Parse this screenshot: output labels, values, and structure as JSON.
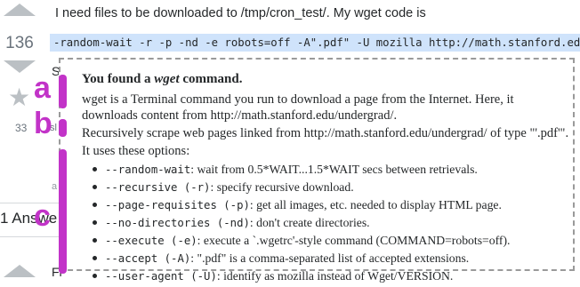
{
  "vote": {
    "count": "136",
    "favorites": "33"
  },
  "question": {
    "intro": "I need files to be downloaded to /tmp/cron_test/. My wget code is",
    "code": "-random-wait -r -p -nd -e robots=off -A\".pdf\" -U mozilla http://math.stanford.edu/undergrad/"
  },
  "behind": {
    "frag1": "Sc",
    "frag2": "sl",
    "frag3": "a",
    "answers": "1 Answe",
    "frag4": "Fr"
  },
  "popup": {
    "title_prefix": "You found a ",
    "title_cmd": "wget",
    "title_suffix": " command.",
    "para1": "wget is a Terminal command you run to download a page from the Internet. Here, it downloads content from http://math.stanford.edu/undergrad/.",
    "para2": "Recursively scrape web pages linked from http://math.stanford.edu/undergrad/ of type \"'.pdf'\".",
    "para3": "It uses these options:",
    "options": [
      {
        "flag": "--random-wait",
        "short": "",
        "desc": ": wait from 0.5*WAIT...1.5*WAIT secs between retrievals."
      },
      {
        "flag": "--recursive",
        "short": " (-r)",
        "desc": ": specify recursive download."
      },
      {
        "flag": "--page-requisites",
        "short": " (-p)",
        "desc": ": get all images, etc. needed to display HTML page."
      },
      {
        "flag": "--no-directories",
        "short": " (-nd)",
        "desc": ": don't create directories."
      },
      {
        "flag": "--execute",
        "short": " (-e)",
        "desc": ": execute a `.wgetrc'-style command (COMMAND=robots=off)."
      },
      {
        "flag": "--accept",
        "short": " (-A)",
        "desc": ": \".pdf\" is a comma-separated list of accepted extensions."
      },
      {
        "flag": "--user-agent",
        "short": " (-U)",
        "desc": ": identify as mozilla instead of Wget/VERSION."
      }
    ]
  },
  "annotations": {
    "a": "a",
    "b": "b",
    "c": "c"
  },
  "colors": {
    "annotation": "#c233c8",
    "code_highlight": "#cfe3fb",
    "vote_arrow": "#bbc0c4"
  }
}
